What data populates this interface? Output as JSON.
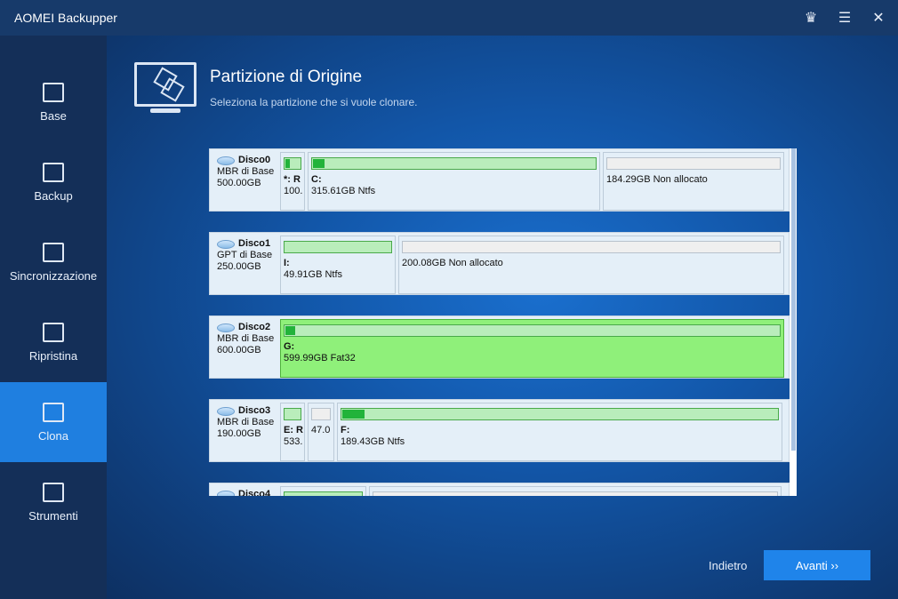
{
  "app": {
    "title": "AOMEI Backupper",
    "icons": [
      "crown-icon",
      "menu-icon",
      "close-icon"
    ]
  },
  "sidebar": {
    "items": [
      {
        "label": "Base"
      },
      {
        "label": "Backup"
      },
      {
        "label": "Sincronizzazione"
      },
      {
        "label": "Ripristina"
      },
      {
        "label": "Clona",
        "active": true
      },
      {
        "label": "Strumenti"
      }
    ]
  },
  "header": {
    "title": "Partizione di Origine",
    "subtitle": "Seleziona la partizione che si vuole clonare."
  },
  "disks": [
    {
      "name": "Disco0",
      "type": "MBR di Base",
      "size": "500.00GB",
      "partitions": [
        {
          "letter": "*: R",
          "info": "100.",
          "used": 0.3
        },
        {
          "letter": "C:",
          "info": "315.61GB Ntfs",
          "used": 0.04
        },
        {
          "letter": "",
          "info": "184.29GB Non allocato",
          "unallocated": true
        }
      ]
    },
    {
      "name": "Disco1",
      "type": "GPT di Base",
      "size": "250.00GB",
      "partitions": [
        {
          "letter": "I:",
          "info": "49.91GB Ntfs",
          "used": 0
        },
        {
          "letter": "",
          "info": "200.08GB Non allocato",
          "unallocated": true
        }
      ]
    },
    {
      "name": "Disco2",
      "type": "MBR di Base",
      "size": "600.00GB",
      "partitions": [
        {
          "letter": "G:",
          "info": "599.99GB Fat32",
          "used": 0.01,
          "selected": true
        }
      ]
    },
    {
      "name": "Disco3",
      "type": "MBR di Base",
      "size": "190.00GB",
      "partitions": [
        {
          "letter": "E: R",
          "info": "533.",
          "used": 0
        },
        {
          "letter": "",
          "info": "47.0",
          "unallocated": true
        },
        {
          "letter": "F:",
          "info": "189.43GB Ntfs",
          "used": 0.05
        }
      ]
    },
    {
      "name": "Disco4",
      "type": "",
      "size": "",
      "partitions": [
        {
          "letter": "",
          "info": "",
          "used": 0
        },
        {
          "letter": "",
          "info": "",
          "unallocated": true
        }
      ]
    }
  ],
  "footer": {
    "back": "Indietro",
    "next": "Avanti ››"
  }
}
